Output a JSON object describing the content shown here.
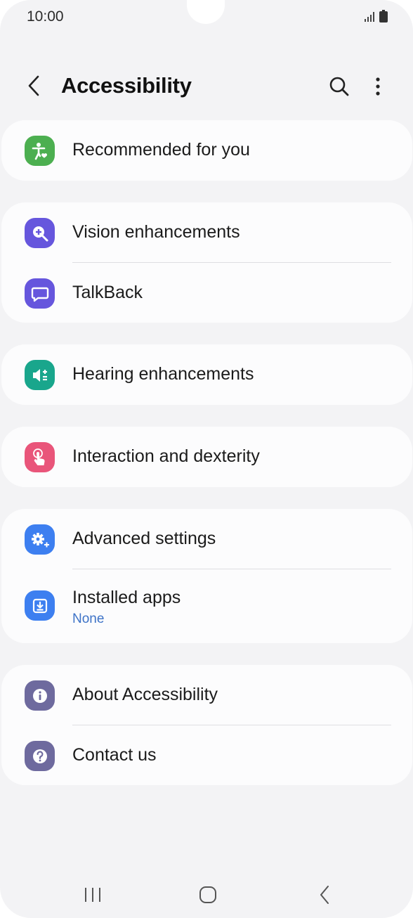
{
  "status": {
    "time": "10:00"
  },
  "header": {
    "title": "Accessibility"
  },
  "cards": [
    {
      "items": [
        {
          "label": "Recommended for you",
          "icon": "accessibility-person-icon",
          "color": "#4caf50"
        }
      ]
    },
    {
      "items": [
        {
          "label": "Vision enhancements",
          "icon": "magnify-plus-icon",
          "color": "#6656dd"
        },
        {
          "label": "TalkBack",
          "icon": "speech-bubble-icon",
          "color": "#6656dd"
        }
      ]
    },
    {
      "items": [
        {
          "label": "Hearing enhancements",
          "icon": "speaker-plus-icon",
          "color": "#19a68c"
        }
      ]
    },
    {
      "items": [
        {
          "label": "Interaction and dexterity",
          "icon": "touch-hand-icon",
          "color": "#e9557a"
        }
      ]
    },
    {
      "items": [
        {
          "label": "Advanced settings",
          "icon": "gear-plus-icon",
          "color": "#3d7ff0"
        },
        {
          "label": "Installed apps",
          "sublabel": "None",
          "icon": "download-icon",
          "color": "#3d7ff0"
        }
      ]
    },
    {
      "items": [
        {
          "label": "About Accessibility",
          "icon": "info-icon",
          "color": "#6e6a9e"
        },
        {
          "label": "Contact us",
          "icon": "question-icon",
          "color": "#6e6a9e"
        }
      ]
    }
  ],
  "colors": {
    "background": "#f3f3f5",
    "card": "#fcfcfd",
    "link": "#3e73c7"
  }
}
